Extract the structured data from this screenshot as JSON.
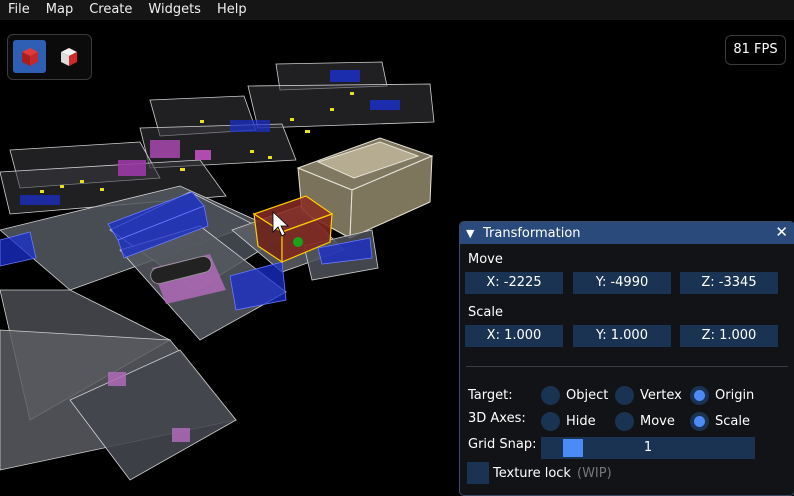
{
  "menu": [
    "File",
    "Map",
    "Create",
    "Widgets",
    "Help"
  ],
  "toolbar": {
    "tools": [
      "solid-cube-icon",
      "textured-cube-icon"
    ],
    "active": 0
  },
  "fps_label": "81 FPS",
  "panel": {
    "title": "Transformation",
    "move_label": "Move",
    "move": {
      "x": "X: -2225",
      "y": "Y: -4990",
      "z": "Z: -3345"
    },
    "scale_label": "Scale",
    "scale": {
      "x": "X: 1.000",
      "y": "Y: 1.000",
      "z": "Z: 1.000"
    },
    "target_label": "Target:",
    "target_options": [
      "Object",
      "Vertex",
      "Origin"
    ],
    "target_selected": "Origin",
    "axes_label": "3D Axes:",
    "axes_options": [
      "Hide",
      "Move",
      "Scale"
    ],
    "axes_selected": "Scale",
    "grid_snap_label": "Grid Snap:",
    "grid_snap_value": "1",
    "texture_lock_label": "Texture lock",
    "texture_lock_note": "(WIP)",
    "texture_lock_checked": false
  },
  "colors": {
    "accent": "#4a8bf5",
    "title_bar": "#294a7a",
    "field": "#1b3352",
    "selection": "#ffcc00"
  }
}
